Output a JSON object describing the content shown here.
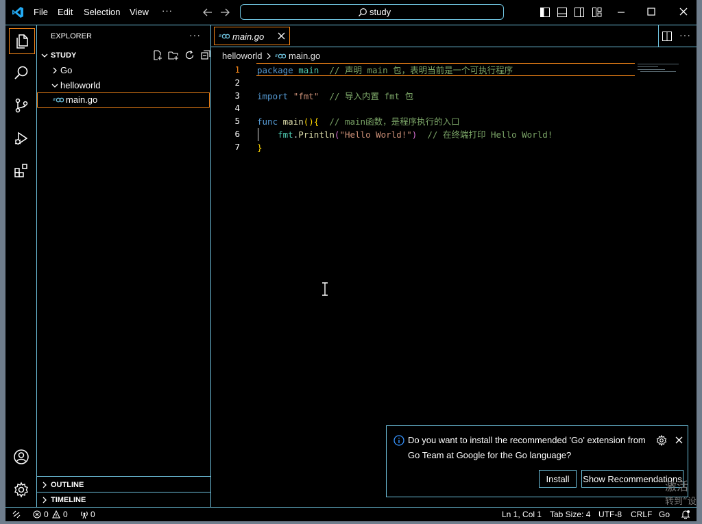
{
  "titlebar": {
    "menus": [
      "File",
      "Edit",
      "Selection",
      "View",
      "···"
    ],
    "command_center": "study"
  },
  "explorer": {
    "title": "EXPLORER",
    "more": "···",
    "root": "STUDY",
    "items": [
      "Go",
      "helloworld",
      "main.go"
    ],
    "outline": "OUTLINE",
    "timeline": "TIMELINE"
  },
  "editor": {
    "tab_label": "main.go",
    "breadcrumb": [
      "helloworld",
      "main.go"
    ],
    "line_numbers": [
      "1",
      "2",
      "3",
      "4",
      "5",
      "6",
      "7"
    ],
    "lines": [
      [
        {
          "t": "package",
          "c": "#569cd6"
        },
        {
          "t": " "
        },
        {
          "t": "main",
          "c": "#4ec9b0"
        },
        {
          "t": "  "
        },
        {
          "t": "// 声明 main 包，表明当前是一个可执行程序",
          "c": "#7ca668"
        }
      ],
      [],
      [
        {
          "t": "import",
          "c": "#569cd6"
        },
        {
          "t": " "
        },
        {
          "t": "\"fmt\"",
          "c": "#ce9178"
        },
        {
          "t": "  "
        },
        {
          "t": "// 导入内置 fmt 包",
          "c": "#7ca668"
        }
      ],
      [],
      [
        {
          "t": "func",
          "c": "#569cd6"
        },
        {
          "t": " "
        },
        {
          "t": "main",
          "c": "#dcdcaa"
        },
        {
          "t": "(){",
          "c": "#ffd700"
        },
        {
          "t": "  "
        },
        {
          "t": "// main函数，是程序执行的入口",
          "c": "#7ca668"
        }
      ],
      [
        {
          "t": "    "
        },
        {
          "t": "fmt",
          "c": "#4ec9b0"
        },
        {
          "t": ".",
          "c": "#d4d4d4"
        },
        {
          "t": "Println",
          "c": "#dcdcaa"
        },
        {
          "t": "(",
          "c": "#da70d6"
        },
        {
          "t": "\"Hello World!\"",
          "c": "#ce9178"
        },
        {
          "t": ")",
          "c": "#da70d6"
        },
        {
          "t": "  "
        },
        {
          "t": "// 在终端打印 Hello World!",
          "c": "#7ca668"
        }
      ],
      [
        {
          "t": "}",
          "c": "#ffd700"
        }
      ]
    ]
  },
  "notification": {
    "message": "Do you want to install the recommended 'Go' extension from Go Team at Google for the Go language?",
    "install": "Install",
    "show_recommendations": "Show Recommendations"
  },
  "watermark": [
    "激活",
    "转到“设"
  ],
  "status": {
    "errors": "0",
    "warnings": "0",
    "ports": "0",
    "position": "Ln 1, Col 1",
    "tab_size": "Tab Size: 4",
    "encoding": "UTF-8",
    "eol": "CRLF",
    "language": "Go"
  },
  "colors": {
    "accent_border": "#6fc3df",
    "focus_border": "#f38518",
    "vscode_blue": "#23a9f2"
  }
}
